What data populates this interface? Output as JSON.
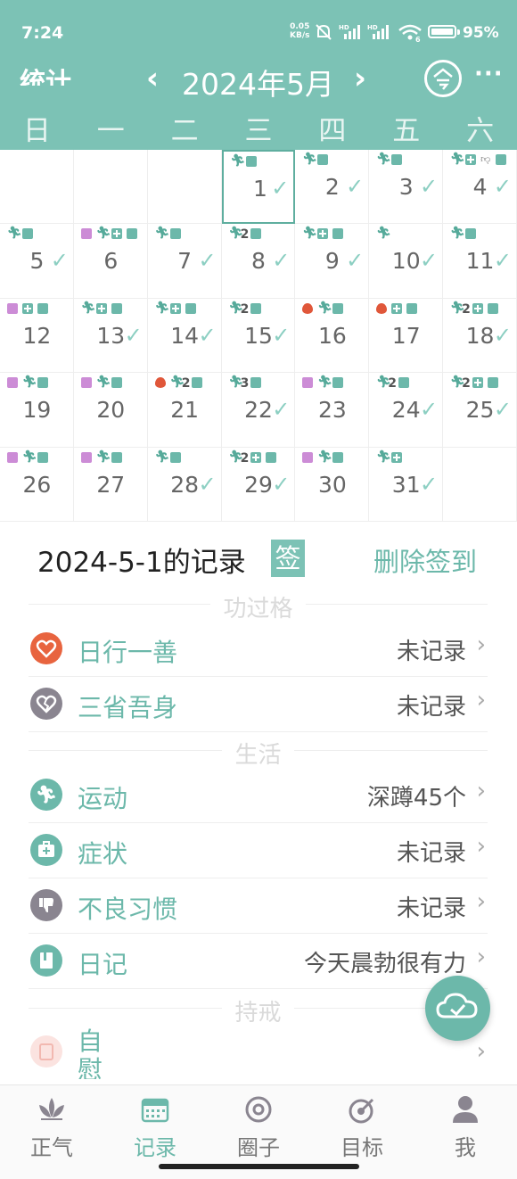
{
  "status_bar": {
    "time": "7:24",
    "net_speed": "0.05",
    "net_unit": "KB/s",
    "signal1": "HD",
    "signal2": "HD",
    "wifi_sub": "6",
    "battery": "95%"
  },
  "header": {
    "left_label": "统计",
    "prev": "‹",
    "month": "2024年5月",
    "next": "›",
    "more": "···"
  },
  "weekdays": [
    "日",
    "一",
    "二",
    "三",
    "四",
    "五",
    "六"
  ],
  "calendar": {
    "selected_day": "1",
    "days": [
      {
        "day": "1",
        "checked": true,
        "icons": [
          "run",
          "diary"
        ]
      },
      {
        "day": "2",
        "checked": true,
        "icons": [
          "run",
          "diary"
        ]
      },
      {
        "day": "3",
        "checked": true,
        "icons": [
          "run",
          "diary"
        ]
      },
      {
        "day": "4",
        "checked": true,
        "icons": [
          "run",
          "med",
          "thumb",
          "diary"
        ]
      },
      {
        "day": "5",
        "checked": true,
        "icons": [
          "run",
          "diary"
        ]
      },
      {
        "day": "6",
        "checked": false,
        "icons": [
          "bed",
          "run",
          "med",
          "diary"
        ]
      },
      {
        "day": "7",
        "checked": true,
        "icons": [
          "run",
          "diary"
        ]
      },
      {
        "day": "8",
        "checked": true,
        "icons": [
          "run2",
          "diary"
        ]
      },
      {
        "day": "9",
        "checked": true,
        "icons": [
          "run",
          "med",
          "diary"
        ]
      },
      {
        "day": "10",
        "checked": true,
        "icons": [
          "run"
        ]
      },
      {
        "day": "11",
        "checked": true,
        "icons": [
          "run",
          "diary"
        ]
      },
      {
        "day": "12",
        "checked": false,
        "icons": [
          "bed",
          "med",
          "diary"
        ]
      },
      {
        "day": "13",
        "checked": true,
        "icons": [
          "run",
          "med",
          "diary"
        ]
      },
      {
        "day": "14",
        "checked": true,
        "icons": [
          "run",
          "med",
          "diary"
        ]
      },
      {
        "day": "15",
        "checked": true,
        "icons": [
          "run2",
          "diary"
        ]
      },
      {
        "day": "16",
        "checked": false,
        "icons": [
          "fire",
          "run",
          "diary"
        ]
      },
      {
        "day": "17",
        "checked": false,
        "icons": [
          "fire",
          "med",
          "diary"
        ]
      },
      {
        "day": "18",
        "checked": true,
        "icons": [
          "run2",
          "med",
          "diary"
        ]
      },
      {
        "day": "19",
        "checked": false,
        "icons": [
          "bed",
          "run",
          "diary"
        ]
      },
      {
        "day": "20",
        "checked": false,
        "icons": [
          "bed",
          "run",
          "diary"
        ]
      },
      {
        "day": "21",
        "checked": false,
        "icons": [
          "fire",
          "run2",
          "diary"
        ]
      },
      {
        "day": "22",
        "checked": true,
        "icons": [
          "run3",
          "diary"
        ]
      },
      {
        "day": "23",
        "checked": false,
        "icons": [
          "bed",
          "run",
          "diary"
        ]
      },
      {
        "day": "24",
        "checked": true,
        "icons": [
          "run2",
          "diary"
        ]
      },
      {
        "day": "25",
        "checked": true,
        "icons": [
          "run2",
          "med",
          "diary"
        ]
      },
      {
        "day": "26",
        "checked": false,
        "icons": [
          "bed",
          "run",
          "diary"
        ]
      },
      {
        "day": "27",
        "checked": false,
        "icons": [
          "bed",
          "run",
          "diary"
        ]
      },
      {
        "day": "28",
        "checked": true,
        "icons": [
          "run",
          "diary"
        ]
      },
      {
        "day": "29",
        "checked": true,
        "icons": [
          "run2",
          "med",
          "diary"
        ]
      },
      {
        "day": "30",
        "checked": false,
        "icons": [
          "bed",
          "run",
          "diary"
        ]
      },
      {
        "day": "31",
        "checked": true,
        "icons": [
          "run",
          "med"
        ]
      }
    ]
  },
  "record": {
    "title": "2024-5-1的记录",
    "sign_badge": "签",
    "delete_label": "删除签到"
  },
  "sections": {
    "merit": "功过格",
    "life": "生活",
    "precepts": "持戒"
  },
  "rows": {
    "good_deed": {
      "label": "日行一善",
      "value": "未记录",
      "arrow": "›"
    },
    "reflect": {
      "label": "三省吾身",
      "value": "未记录",
      "arrow": "›"
    },
    "exercise": {
      "label": "运动",
      "value": "深蹲45个",
      "arrow": "›"
    },
    "symptom": {
      "label": "症状",
      "value": "未记录",
      "arrow": "›"
    },
    "habit": {
      "label": "不良习惯",
      "value": "未记录",
      "arrow": "›"
    },
    "diary": {
      "label": "日记",
      "value": "今天晨勃很有力",
      "arrow": "›"
    },
    "self": {
      "label": "自慰",
      "value": "",
      "arrow": "›"
    }
  },
  "tabs": [
    {
      "label": "正气",
      "icon": "lotus-icon"
    },
    {
      "label": "记录",
      "icon": "calendar-icon"
    },
    {
      "label": "圈子",
      "icon": "circle-icon"
    },
    {
      "label": "目标",
      "icon": "target-icon"
    },
    {
      "label": "我",
      "icon": "person-icon"
    }
  ],
  "colors": {
    "accent": "#7cc2b5",
    "accent_text": "#6cb8aa",
    "fire": "#e0573a",
    "heart": "#e8643f"
  }
}
